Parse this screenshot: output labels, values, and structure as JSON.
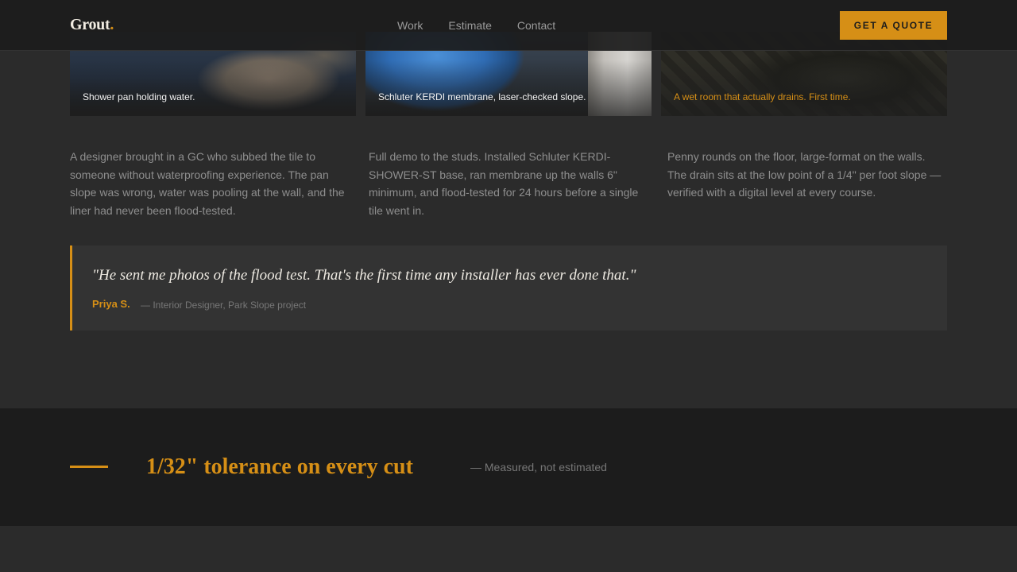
{
  "header": {
    "logo_text": "Grout",
    "logo_dot": ".",
    "nav": [
      "Work",
      "Estimate",
      "Contact"
    ],
    "cta_label": "GET A QUOTE"
  },
  "cards": [
    {
      "caption": "Shower pan holding water."
    },
    {
      "caption": "Schluter KERDI membrane, laser-checked slope."
    },
    {
      "caption": "A wet room that actually drains. First time."
    }
  ],
  "descriptions": [
    "A designer brought in a GC who subbed the tile to someone without waterproofing experience. The pan slope was wrong, water was pooling at the wall, and the liner had never been flood-tested.",
    "Full demo to the studs. Installed Schluter KERDI-SHOWER-ST base, ran membrane up the walls 6\" minimum, and flood-tested for 24 hours before a single tile went in.",
    "Penny rounds on the floor, large-format on the walls. The drain sits at the low point of a 1/4\" per foot slope — verified with a digital level at every course."
  ],
  "testimonial": {
    "quote": "\"He sent me photos of the flood test. That's the first time any installer has ever done that.\"",
    "author": "Priya S.",
    "role": "— Interior Designer, Park Slope project"
  },
  "stat": {
    "headline": "1/32\" tolerance on every cut",
    "sub": "— Measured, not estimated"
  },
  "colors": {
    "accent": "#d68f16",
    "background": "#2b2b2b",
    "band": "#1c1c1c"
  }
}
